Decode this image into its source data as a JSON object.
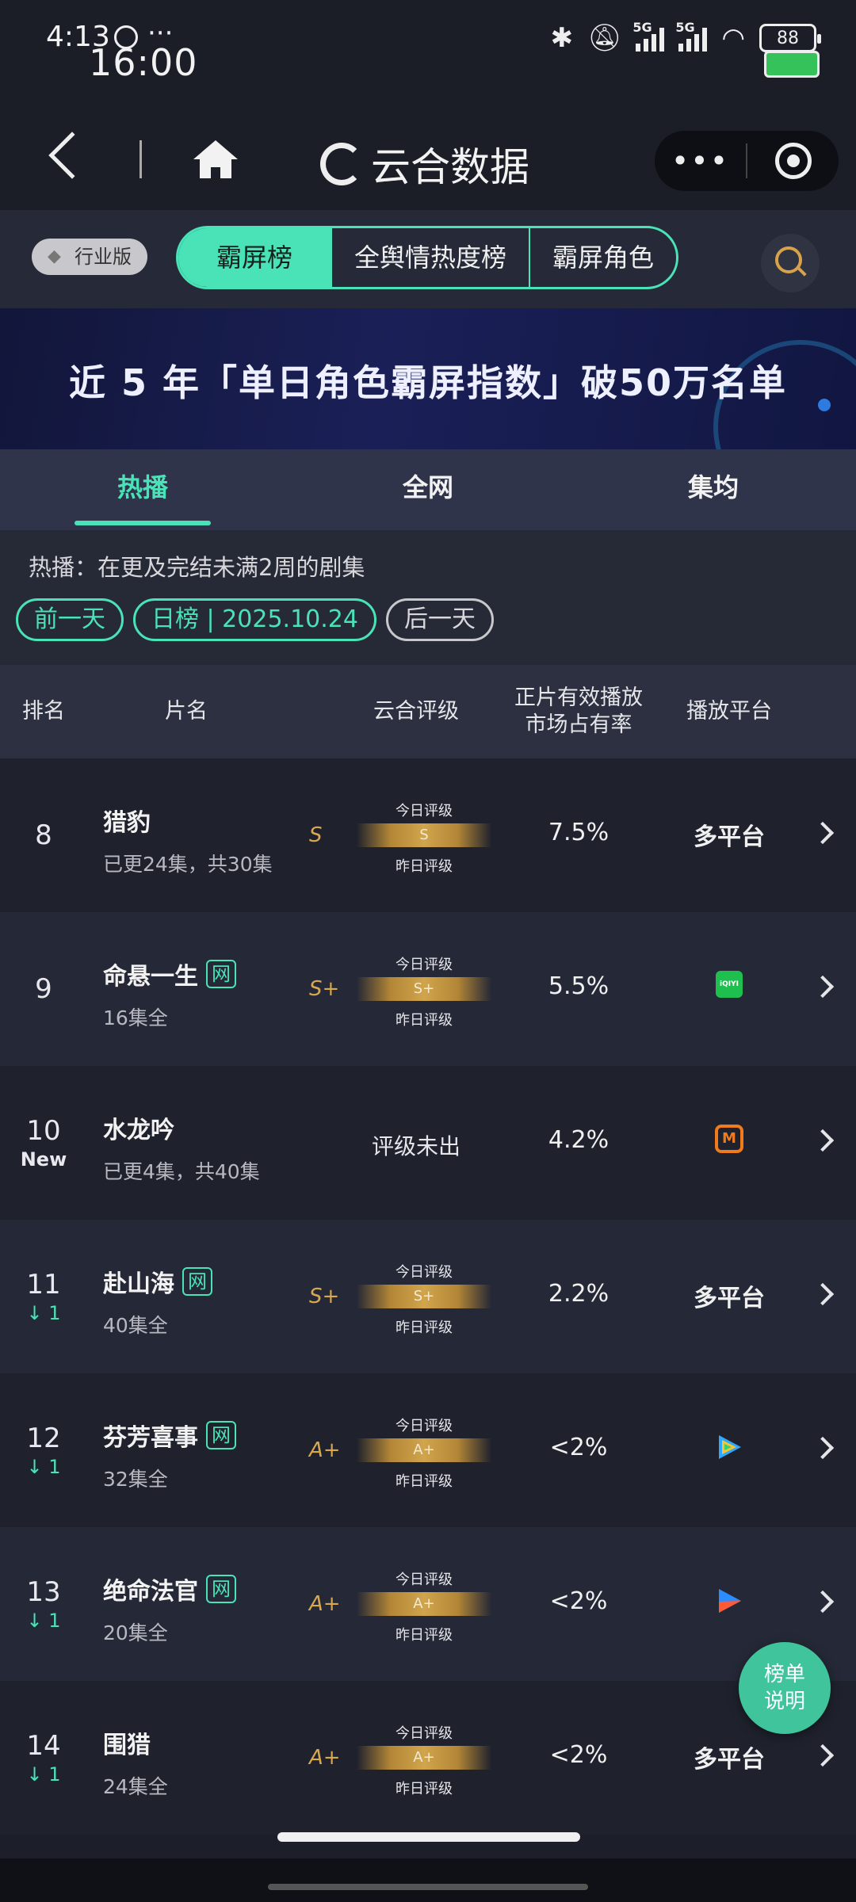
{
  "status": {
    "time_small": "4:13",
    "time_big": "16:00",
    "dots": "···",
    "battery": "88",
    "net1": "5G",
    "net2": "5G"
  },
  "nav": {
    "title": "云合数据",
    "more": "•••"
  },
  "toprow": {
    "industry": "行业版",
    "tabs": [
      "霸屏榜",
      "全舆情热度榜",
      "霸屏角色"
    ]
  },
  "banner": {
    "text": "近 5 年「单日角色霸屏指数」破50万名单"
  },
  "subtabs": [
    "热播",
    "全网",
    "集均"
  ],
  "desc": "热播：在更及完结未满2周的剧集",
  "date": {
    "prev": "前一天",
    "current": "日榜 | 2025.10.24",
    "next": "后一天"
  },
  "table_header": {
    "rank": "排名",
    "name": "片名",
    "grade": "云合评级",
    "share_line1": "正片有效播放",
    "share_line2": "市场占有率",
    "platform": "播放平台"
  },
  "grade_labels": {
    "today": "今日评级",
    "yesterday": "昨日评级",
    "none": "评级未出"
  },
  "rows": [
    {
      "rank": "8",
      "sub": "",
      "name": "猎豹",
      "tag": "",
      "episodes": "已更24集，共30集",
      "grade": "S",
      "bar": "S",
      "share": "7.5%",
      "platform": "多平台",
      "platform_icon": ""
    },
    {
      "rank": "9",
      "sub": "",
      "name": "命悬一生",
      "tag": "网",
      "episodes": "16集全",
      "grade": "S+",
      "bar": "S+",
      "share": "5.5%",
      "platform": "",
      "platform_icon": "iqiyi-icon"
    },
    {
      "rank": "10",
      "sub": "New",
      "name": "水龙吟",
      "tag": "",
      "episodes": "已更4集，共40集",
      "grade": "",
      "bar": "",
      "share": "4.2%",
      "platform": "",
      "platform_icon": "mango-tv-icon"
    },
    {
      "rank": "11",
      "sub": "↓ 1",
      "name": "赴山海",
      "tag": "网",
      "episodes": "40集全",
      "grade": "S+",
      "bar": "S+",
      "share": "2.2%",
      "platform": "多平台",
      "platform_icon": ""
    },
    {
      "rank": "12",
      "sub": "↓ 1",
      "name": "芬芳喜事",
      "tag": "网",
      "episodes": "32集全",
      "grade": "A+",
      "bar": "A+",
      "share": "<2%",
      "platform": "",
      "platform_icon": "tencent-video-icon"
    },
    {
      "rank": "13",
      "sub": "↓ 1",
      "name": "绝命法官",
      "tag": "网",
      "episodes": "20集全",
      "grade": "A+",
      "bar": "A+",
      "share": "<2%",
      "platform": "",
      "platform_icon": "youku-icon"
    },
    {
      "rank": "14",
      "sub": "↓ 1",
      "name": "围猎",
      "tag": "",
      "episodes": "24集全",
      "grade": "A+",
      "bar": "A+",
      "share": "<2%",
      "platform": "多平台",
      "platform_icon": ""
    }
  ],
  "icons": {
    "iqiyi_text": "iQIYI",
    "mango_text": "M"
  },
  "fab": {
    "line1": "榜单",
    "line2": "说明"
  },
  "colors": {
    "accent": "#49e3b7",
    "gold": "#d9a84c",
    "background": "#1c1f2a"
  }
}
